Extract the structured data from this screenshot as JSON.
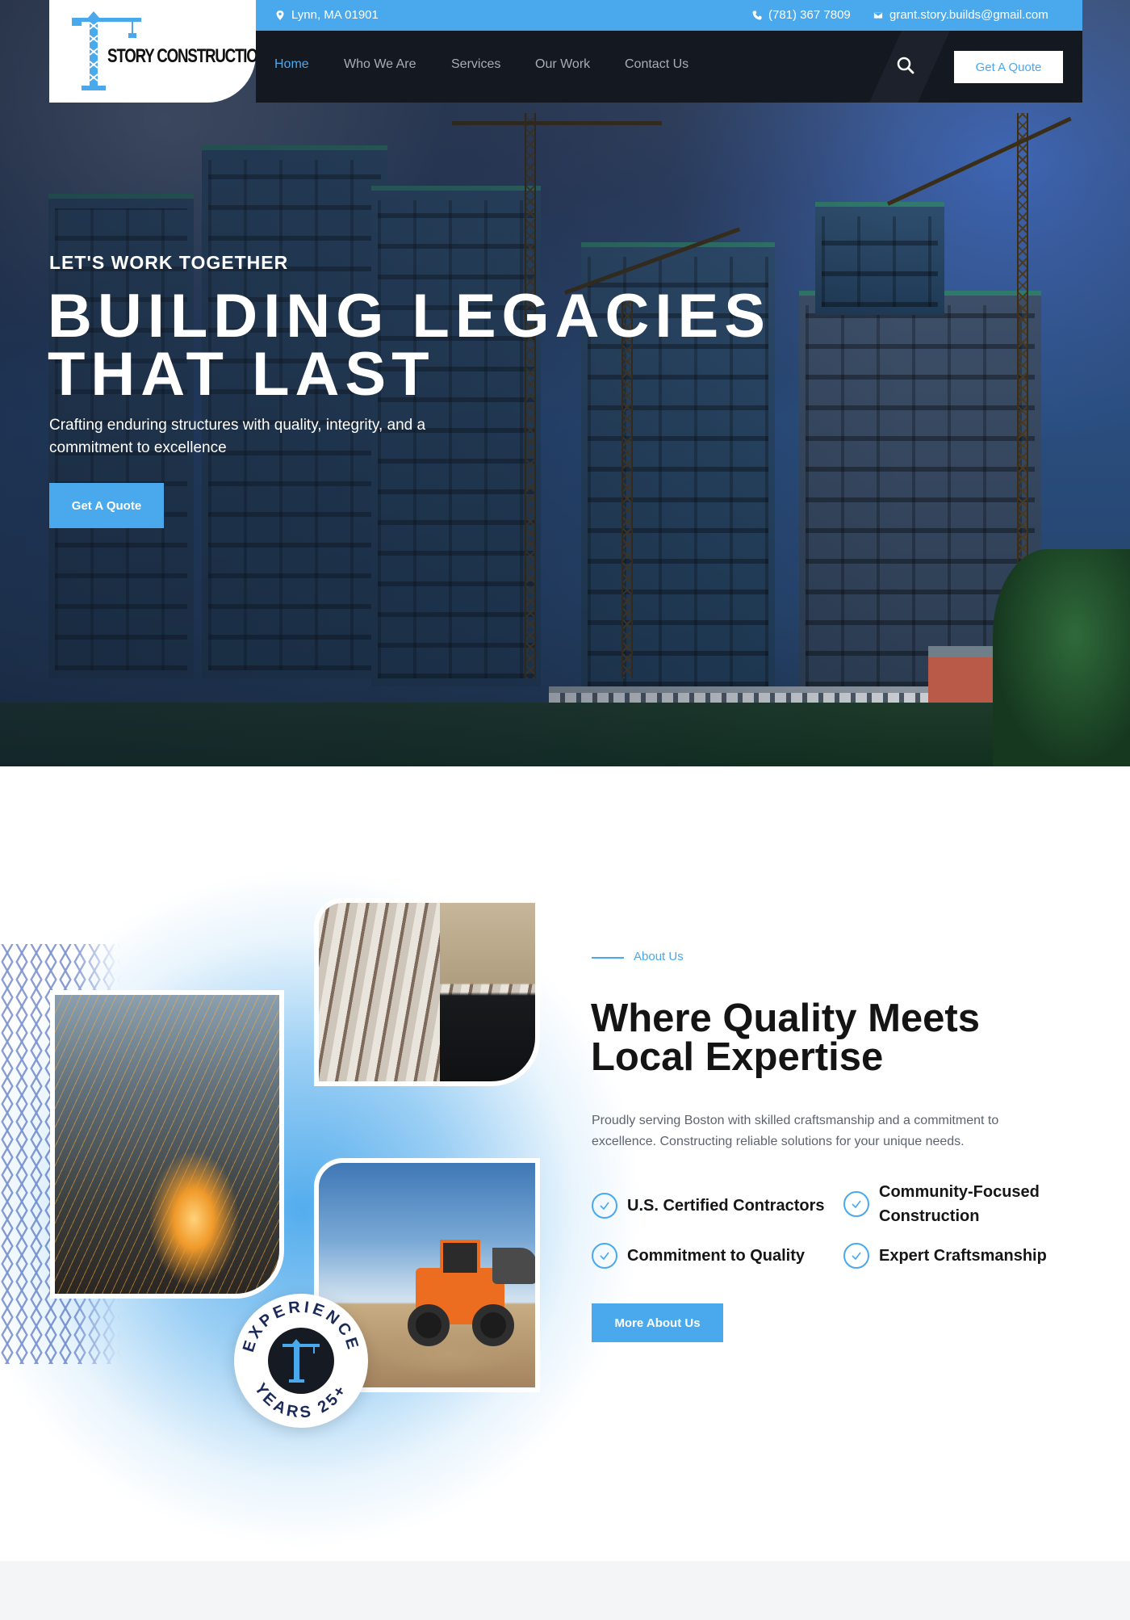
{
  "brand": {
    "logo_text": "STORY CONSTRUCTION",
    "accent_color": "#4aa8ec",
    "dark_color": "#141821"
  },
  "topbar": {
    "location": "Lynn, MA 01901",
    "location_icon": "map-pin-icon",
    "phone": "(781) 367 7809",
    "phone_icon": "phone-icon",
    "email": "grant.story.builds@gmail.com",
    "email_icon": "envelope-icon"
  },
  "nav": {
    "items": [
      {
        "label": "Home",
        "active": true
      },
      {
        "label": "Who We Are"
      },
      {
        "label": "Services"
      },
      {
        "label": "Our Work"
      },
      {
        "label": "Contact Us"
      }
    ],
    "search_icon": "search-icon",
    "cta_label": "Get A Quote"
  },
  "hero": {
    "kicker": "LET'S WORK TOGETHER",
    "title_line1": "BUILDING LEGACIES",
    "title_line2": "THAT LAST",
    "subtitle": "Crafting enduring structures with quality, integrity, and a commitment to excellence",
    "cta_label": "Get A Quote"
  },
  "about": {
    "kicker": "About Us",
    "title": "Where Quality Meets Local Expertise",
    "description": "Proudly serving Boston with skilled craftsmanship and a commitment to excellence. Constructing reliable solutions for your unique needs.",
    "features": [
      "U.S. Certified Contractors",
      "Community-Focused Construction",
      "Commitment to Quality",
      "Expert Craftsmanship"
    ],
    "cta_label": "More About Us",
    "badge_text": "EXPERIENCE",
    "badge_years": "YEARS 25+"
  }
}
